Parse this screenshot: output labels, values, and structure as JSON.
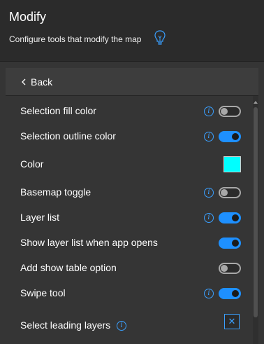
{
  "header": {
    "title": "Modify",
    "subtitle": "Configure tools that modify the map",
    "icon": "lightbulb-icon"
  },
  "panel": {
    "back_label": "Back",
    "settings": [
      {
        "label": "Selection fill color",
        "info": true,
        "control": "toggle",
        "enabled": false
      },
      {
        "label": "Selection outline color",
        "info": true,
        "control": "toggle",
        "enabled": true
      },
      {
        "label": "Color",
        "info": false,
        "control": "color",
        "color": "#00FFFF"
      },
      {
        "label": "Basemap toggle",
        "info": true,
        "control": "toggle",
        "enabled": false
      },
      {
        "label": "Layer list",
        "info": true,
        "control": "toggle",
        "enabled": true
      },
      {
        "label": "Show layer list when app opens",
        "info": false,
        "control": "toggle",
        "enabled": true
      },
      {
        "label": "Add show table option",
        "info": false,
        "control": "toggle",
        "enabled": false
      },
      {
        "label": "Swipe tool",
        "info": true,
        "control": "toggle",
        "enabled": true
      },
      {
        "label": "Select leading layers",
        "info": true,
        "control": "select",
        "symbol": "✕"
      }
    ]
  },
  "colors": {
    "accent": "#1E90FF",
    "swatch": "#00FFFF",
    "background": "#353535",
    "header_bg": "#2B2B2B"
  }
}
